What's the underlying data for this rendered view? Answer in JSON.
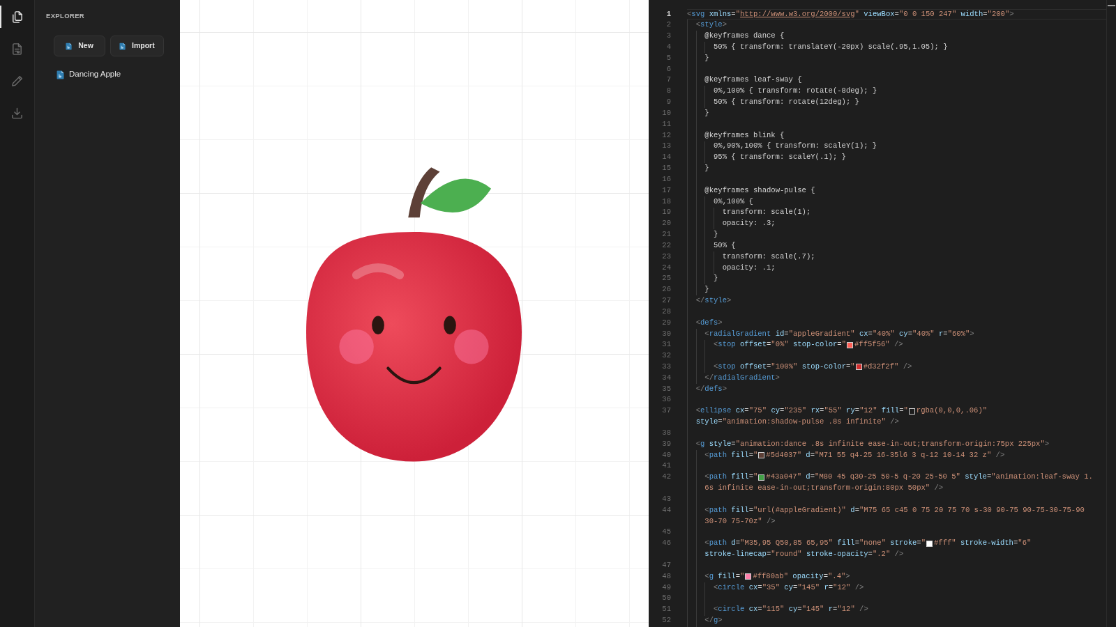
{
  "activity_bar": {
    "items": [
      {
        "kind": "files",
        "selected": true
      },
      {
        "kind": "document",
        "selected": false
      },
      {
        "kind": "pencil",
        "selected": false
      },
      {
        "kind": "download",
        "selected": false
      }
    ]
  },
  "explorer": {
    "title": "EXPLORER",
    "buttons": [
      {
        "label": "New"
      },
      {
        "label": "Import"
      }
    ],
    "files": [
      {
        "name": "Dancing Apple"
      }
    ]
  },
  "editor": {
    "lines": [
      {
        "number": "1",
        "current": true,
        "rows": [
          [
            {
              "kind": "code",
              "text": "<svg xmlns=\""
            },
            {
              "kind": "link",
              "text": "http://www.w3.org/2000/svg"
            },
            {
              "kind": "code",
              "text": "\" viewBox=\"0 0 150 247\" width=\"200\">"
            }
          ]
        ]
      },
      {
        "number": "2",
        "current": false,
        "rows": [
          [
            {
              "kind": "code",
              "text": "  <style>"
            }
          ]
        ]
      },
      {
        "number": "3",
        "current": false,
        "rows": [
          [
            {
              "kind": "code",
              "text": "    @keyframes dance {"
            }
          ]
        ]
      },
      {
        "number": "4",
        "current": false,
        "rows": [
          [
            {
              "kind": "code",
              "text": "      50% { transform: translateY(-20px) scale(.95,1.05); }"
            }
          ]
        ]
      },
      {
        "number": "5",
        "current": false,
        "rows": [
          [
            {
              "kind": "code",
              "text": "    }"
            }
          ]
        ]
      },
      {
        "number": "6",
        "current": false
      },
      {
        "number": "7",
        "current": false,
        "rows": [
          [
            {
              "kind": "code",
              "text": "    @keyframes leaf-sway {"
            }
          ]
        ]
      },
      {
        "number": "8",
        "current": false,
        "rows": [
          [
            {
              "kind": "code",
              "text": "      0%,100% { transform: rotate(-8deg); }"
            }
          ]
        ]
      },
      {
        "number": "9",
        "current": false,
        "rows": [
          [
            {
              "kind": "code",
              "text": "      50% { transform: rotate(12deg); }"
            }
          ]
        ]
      },
      {
        "number": "10",
        "current": false,
        "rows": [
          [
            {
              "kind": "code",
              "text": "    }"
            }
          ]
        ]
      },
      {
        "number": "11",
        "current": false
      },
      {
        "number": "12",
        "current": false,
        "rows": [
          [
            {
              "kind": "code",
              "text": "    @keyframes blink {"
            }
          ]
        ]
      },
      {
        "number": "13",
        "current": false,
        "rows": [
          [
            {
              "kind": "code",
              "text": "      0%,90%,100% { transform: scaleY(1); }"
            }
          ]
        ]
      },
      {
        "number": "14",
        "current": false,
        "rows": [
          [
            {
              "kind": "code",
              "text": "      95% { transform: scaleY(.1); }"
            }
          ]
        ]
      },
      {
        "number": "15",
        "current": false,
        "rows": [
          [
            {
              "kind": "code",
              "text": "    }"
            }
          ]
        ]
      },
      {
        "number": "16",
        "current": false
      },
      {
        "number": "17",
        "current": false,
        "rows": [
          [
            {
              "kind": "code",
              "text": "    @keyframes shadow-pulse {"
            }
          ]
        ]
      },
      {
        "number": "18",
        "current": false,
        "rows": [
          [
            {
              "kind": "code",
              "text": "      0%,100% {"
            }
          ]
        ]
      },
      {
        "number": "19",
        "current": false,
        "rows": [
          [
            {
              "kind": "code",
              "text": "        transform: scale(1);"
            }
          ]
        ]
      },
      {
        "number": "20",
        "current": false,
        "rows": [
          [
            {
              "kind": "code",
              "text": "        opacity: .3;"
            }
          ]
        ]
      },
      {
        "number": "21",
        "current": false,
        "rows": [
          [
            {
              "kind": "code",
              "text": "      }"
            }
          ]
        ]
      },
      {
        "number": "22",
        "current": false,
        "rows": [
          [
            {
              "kind": "code",
              "text": "      50% {"
            }
          ]
        ]
      },
      {
        "number": "23",
        "current": false,
        "rows": [
          [
            {
              "kind": "code",
              "text": "        transform: scale(.7);"
            }
          ]
        ]
      },
      {
        "number": "24",
        "current": false,
        "rows": [
          [
            {
              "kind": "code",
              "text": "        opacity: .1;"
            }
          ]
        ]
      },
      {
        "number": "25",
        "current": false,
        "rows": [
          [
            {
              "kind": "code",
              "text": "      }"
            }
          ]
        ]
      },
      {
        "number": "26",
        "current": false,
        "rows": [
          [
            {
              "kind": "code",
              "text": "    }"
            }
          ]
        ]
      },
      {
        "number": "27",
        "current": false,
        "rows": [
          [
            {
              "kind": "code",
              "text": "  </style>"
            }
          ]
        ]
      },
      {
        "number": "28",
        "current": false
      },
      {
        "number": "29",
        "current": false,
        "rows": [
          [
            {
              "kind": "code",
              "text": "  <defs>"
            }
          ]
        ]
      },
      {
        "number": "30",
        "current": false,
        "rows": [
          [
            {
              "kind": "code",
              "text": "    <radialGradient id=\"appleGradient\" cx=\"40%\" cy=\"40%\" r=\"60%\">"
            }
          ]
        ]
      },
      {
        "number": "31",
        "current": false,
        "rows": [
          [
            {
              "kind": "code",
              "text": "      <stop offset=\"0%\" stop-color=\""
            },
            {
              "kind": "swatch",
              "color": "#ff5f56"
            },
            {
              "kind": "code",
              "text": "#ff5f56\" />"
            }
          ]
        ]
      },
      {
        "number": "32",
        "current": false
      },
      {
        "number": "33",
        "current": false,
        "rows": [
          [
            {
              "kind": "code",
              "text": "      <stop offset=\"100%\" stop-color=\""
            },
            {
              "kind": "swatch",
              "color": "#d32f2f"
            },
            {
              "kind": "code",
              "text": "#d32f2f\" />"
            }
          ]
        ]
      },
      {
        "number": "34",
        "current": false,
        "rows": [
          [
            {
              "kind": "code",
              "text": "    </radialGradient>"
            }
          ]
        ]
      },
      {
        "number": "35",
        "current": false,
        "rows": [
          [
            {
              "kind": "code",
              "text": "  </defs>"
            }
          ]
        ]
      },
      {
        "number": "36",
        "current": false
      },
      {
        "number": "37",
        "current": false,
        "rows": [
          [
            {
              "kind": "code",
              "text": "  <ellipse cx=\"75\" cy=\"235\" rx=\"55\" ry=\"12\" fill=\""
            },
            {
              "kind": "swatch",
              "color": "#1c1c1c"
            },
            {
              "kind": "code",
              "text": "rgba(0,0,0,.06)\""
            }
          ],
          [
            {
              "kind": "code",
              "text": "  style=\"animation:shadow-pulse .8s infinite\" />"
            }
          ]
        ]
      },
      {
        "number": "38",
        "current": false
      },
      {
        "number": "39",
        "current": false,
        "rows": [
          [
            {
              "kind": "code",
              "text": "  <g style=\"animation:dance .8s infinite ease-in-out;transform-origin:75px 225px\">"
            }
          ]
        ]
      },
      {
        "number": "40",
        "current": false,
        "rows": [
          [
            {
              "kind": "code",
              "text": "    <path fill=\""
            },
            {
              "kind": "swatch",
              "color": "#5d4037"
            },
            {
              "kind": "code",
              "text": "#5d4037\" d=\"M71 55 q4-25 16-35l6 3 q-12 10-14 32 z\" />"
            }
          ]
        ]
      },
      {
        "number": "41",
        "current": false
      },
      {
        "number": "42",
        "current": false,
        "rows": [
          [
            {
              "kind": "code",
              "text": "    <path fill=\""
            },
            {
              "kind": "swatch",
              "color": "#43a047"
            },
            {
              "kind": "code",
              "text": "#43a047\" d=\"M80 45 q30-25 50-5 q-20 25-50 5\" style=\"animation:leaf-sway 1."
            }
          ],
          [
            {
              "kind": "code",
              "text": "    6s infinite ease-in-out;transform-origin:80px 50px\" />"
            }
          ]
        ]
      },
      {
        "number": "43",
        "current": false
      },
      {
        "number": "44",
        "current": false,
        "rows": [
          [
            {
              "kind": "code",
              "text": "    <path fill=\"url(#appleGradient)\" d=\"M75 65 c45 0 75 20 75 70 s-30 90-75 90-75-30-75-90"
            }
          ],
          [
            {
              "kind": "code",
              "text": "    30-70 75-70z\" />"
            }
          ]
        ]
      },
      {
        "number": "45",
        "current": false
      },
      {
        "number": "46",
        "current": false,
        "rows": [
          [
            {
              "kind": "code",
              "text": "    <path d=\"M35,95 Q50,85 65,95\" fill=\"none\" stroke=\""
            },
            {
              "kind": "swatch",
              "color": "#ffffff"
            },
            {
              "kind": "code",
              "text": "#fff\" stroke-width=\"6\""
            }
          ],
          [
            {
              "kind": "code",
              "text": "    stroke-linecap=\"round\" stroke-opacity=\".2\" />"
            }
          ]
        ]
      },
      {
        "number": "47",
        "current": false
      },
      {
        "number": "48",
        "current": false,
        "rows": [
          [
            {
              "kind": "code",
              "text": "    <g fill=\""
            },
            {
              "kind": "swatch",
              "color": "#ff80ab"
            },
            {
              "kind": "code",
              "text": "#ff80ab\" opacity=\".4\">"
            }
          ]
        ]
      },
      {
        "number": "49",
        "current": false,
        "rows": [
          [
            {
              "kind": "code",
              "text": "      <circle cx=\"35\" cy=\"145\" r=\"12\" />"
            }
          ]
        ]
      },
      {
        "number": "50",
        "current": false
      },
      {
        "number": "51",
        "current": false,
        "rows": [
          [
            {
              "kind": "code",
              "text": "      <circle cx=\"115\" cy=\"145\" r=\"12\" />"
            }
          ]
        ]
      },
      {
        "number": "52",
        "current": false,
        "rows": [
          [
            {
              "kind": "code",
              "text": "    </g>"
            }
          ]
        ]
      }
    ]
  }
}
